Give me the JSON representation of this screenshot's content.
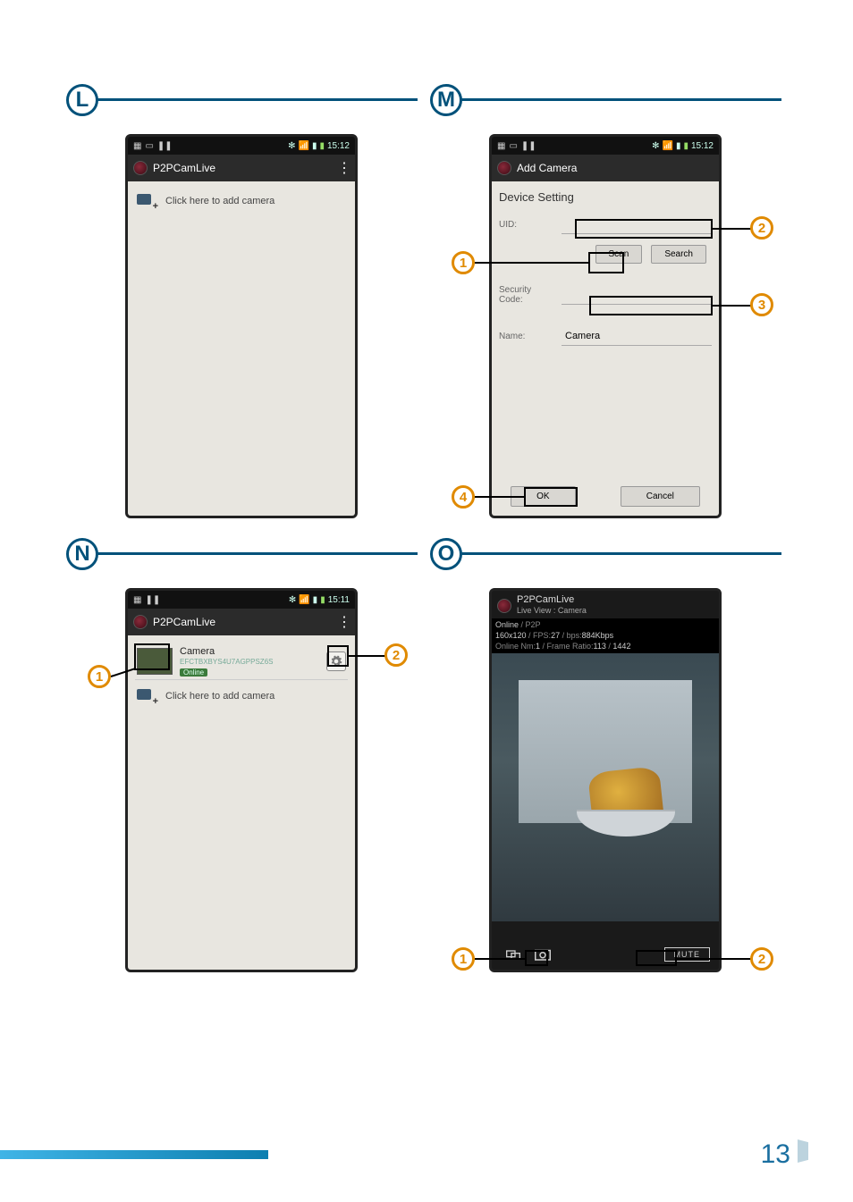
{
  "footer": {
    "page_number": "13"
  },
  "sections": {
    "L": {
      "badge": "L"
    },
    "M": {
      "badge": "M"
    },
    "N": {
      "badge": "N"
    },
    "O": {
      "badge": "O"
    }
  },
  "status": {
    "time": "15:12",
    "time_n": "15:11",
    "bt_glyph": "✻",
    "wifi_glyph": "▾",
    "sig_glyph": "▮",
    "batt_glyph": "▮"
  },
  "screenL": {
    "title": "P2PCamLive",
    "add_label": "Click here to add camera"
  },
  "screenM": {
    "title": "Add Camera",
    "section": "Device Setting",
    "uid_label": "UID:",
    "uid_value": "",
    "scan": "Scan",
    "search": "Search",
    "code_label": "Security Code:",
    "code_value": "",
    "name_label": "Name:",
    "name_value": "Camera",
    "ok": "OK",
    "cancel": "Cancel",
    "callouts": {
      "c1": "1",
      "c2": "2",
      "c3": "3",
      "c4": "4"
    }
  },
  "screenN": {
    "title": "P2PCamLive",
    "cam_name": "Camera",
    "cam_uid": "EFCTBXBYS4U7AGPPSZ6S",
    "cam_status": "Online",
    "add_label": "Click here to add camera",
    "callouts": {
      "c1": "1",
      "c2": "2"
    }
  },
  "screenO": {
    "title": "P2PCamLive",
    "subtitle": "Live View : Camera",
    "line1a": "Online",
    "line1b": " / P2P",
    "line2a": "160x120",
    "line2b": " / FPS:",
    "line2c": "27",
    "line2d": " / bps:",
    "line2e": "884Kbps",
    "line3a": "Online Nm:",
    "line3b": "1",
    "line3c": " / Frame Ratio:",
    "line3d": "113",
    "line3e": " / ",
    "line3f": "1442",
    "mute": "MUTE",
    "callouts": {
      "c1": "1",
      "c2": "2"
    }
  }
}
